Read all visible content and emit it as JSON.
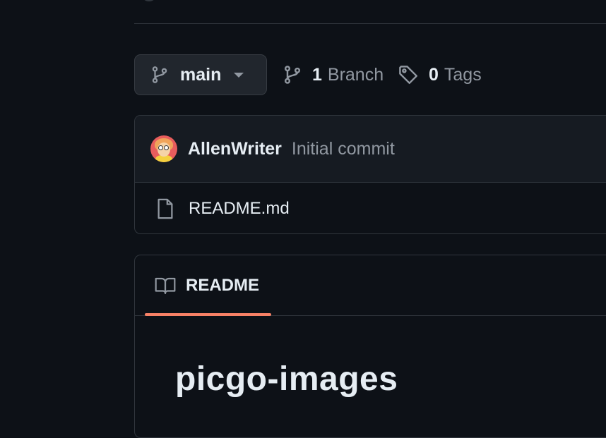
{
  "branch": {
    "current": "main"
  },
  "branches": {
    "count": "1",
    "label": "Branch"
  },
  "tags": {
    "count": "0",
    "label": "Tags"
  },
  "latest_commit": {
    "author": "AllenWriter",
    "message": "Initial commit"
  },
  "files": [
    {
      "name": "README.md",
      "type": "file"
    }
  ],
  "readme": {
    "tab_label": "README",
    "heading": "picgo-images"
  },
  "colors": {
    "background": "#0d1117",
    "border": "#30363d",
    "muted_text": "#9198a1",
    "tab_accent": "#f78166"
  },
  "icons": {
    "branch": "git-branch-icon",
    "tag": "tag-icon",
    "file": "file-icon",
    "book": "book-icon",
    "caret": "caret-down-icon"
  }
}
